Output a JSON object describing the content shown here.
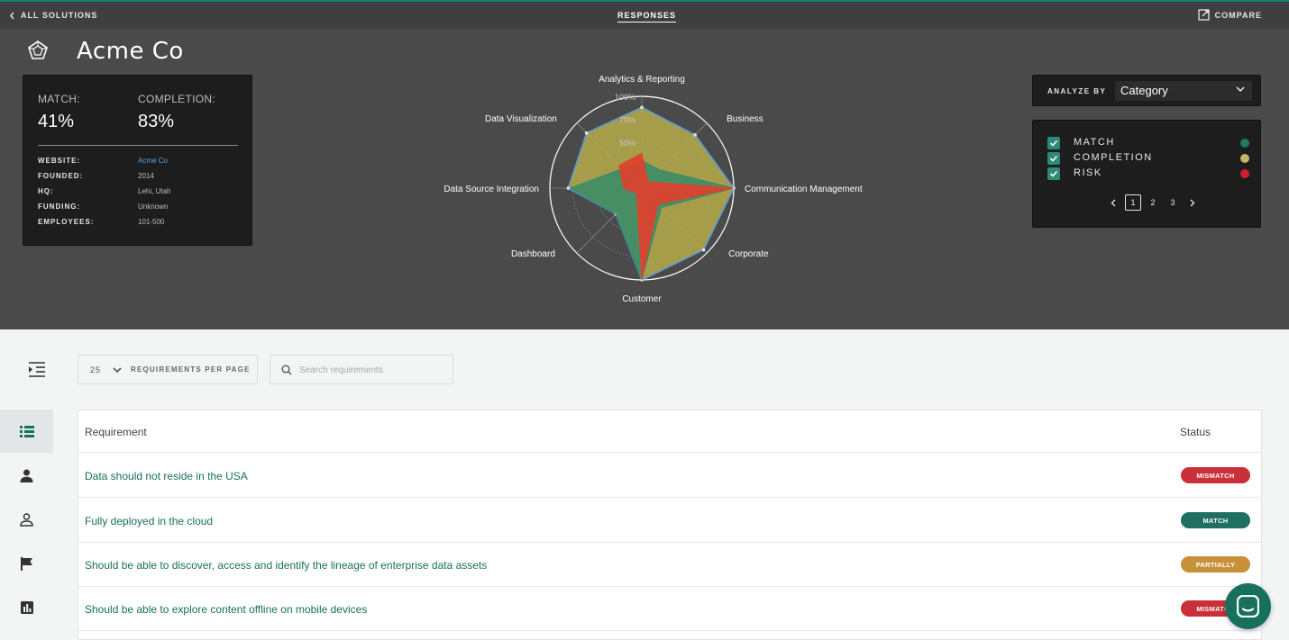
{
  "nav": {
    "back_label": "ALL SOLUTIONS",
    "center_label": "RESPONSES",
    "compare_label": "COMPARE"
  },
  "company": {
    "name": "Acme Co",
    "match_label": "MATCH:",
    "match_value": "41%",
    "completion_label": "COMPLETION:",
    "completion_value": "83%",
    "info": [
      {
        "label": "WEBSITE:",
        "value": "Acme Co"
      },
      {
        "label": "FOUNDED:",
        "value": "2014"
      },
      {
        "label": "HQ:",
        "value": "Lehi, Utah"
      },
      {
        "label": "FUNDING:",
        "value": "Unknown"
      },
      {
        "label": "EMPLOYEES:",
        "value": "101-500"
      }
    ]
  },
  "chart_data": {
    "type": "radar",
    "categories": [
      "Analytics & Reporting",
      "Business",
      "Communication Management",
      "Corporate",
      "Customer",
      "Dashboard",
      "Data Source Integration",
      "Data Visualization"
    ],
    "rmax": 100,
    "tick_labels": [
      "100%",
      "75%",
      "50%"
    ],
    "series": [
      {
        "name": "COMPLETION",
        "color": "#b5ac4a",
        "values": [
          88,
          82,
          100,
          95,
          100,
          40,
          80,
          85
        ]
      },
      {
        "name": "MATCH",
        "color": "#2a8a6f",
        "values": [
          30,
          28,
          100,
          30,
          100,
          40,
          78,
          30
        ]
      },
      {
        "name": "RISK",
        "color": "#e0412e",
        "values": [
          38,
          10,
          100,
          25,
          100,
          8,
          20,
          35
        ]
      }
    ]
  },
  "analyze": {
    "label": "ANALYZE BY",
    "selected": "Category"
  },
  "legend": {
    "items": [
      {
        "label": "MATCH",
        "color": "#1f7a66"
      },
      {
        "label": "COMPLETION",
        "color": "#c4b666"
      },
      {
        "label": "RISK",
        "color": "#cf1f2b"
      }
    ],
    "pages": [
      "1",
      "2",
      "3"
    ]
  },
  "toolbar": {
    "per_page_value": "25",
    "per_page_label": "REQUIREMENTS PER PAGE",
    "search_placeholder": "Search requirements"
  },
  "table": {
    "col_requirement": "Requirement",
    "col_status": "Status",
    "rows": [
      {
        "text": "Data should not reside in the USA",
        "status": "MISMATCH",
        "color": "#c9303a"
      },
      {
        "text": "Fully deployed in the cloud",
        "status": "MATCH",
        "color": "#1f7063"
      },
      {
        "text": "Should be able to discover, access and identify the lineage of enterprise data assets",
        "status": "PARTIALLY",
        "color": "#c7913a"
      },
      {
        "text": "Should be able to explore content offline on mobile devices",
        "status": "MISMATCH",
        "color": "#c9303a"
      }
    ]
  }
}
